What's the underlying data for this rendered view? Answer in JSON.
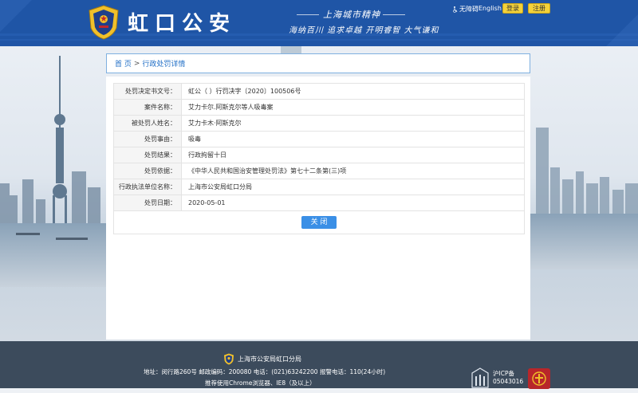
{
  "header": {
    "brand_title": "虹口公安",
    "slogan_top": "上海城市精神",
    "slogan_bottom": "海纳百川 追求卓越 开明睿智 大气谦和",
    "accessibility_label": "无障碍",
    "english_label": "English",
    "login_label": "登录",
    "register_label": "注册"
  },
  "breadcrumb": {
    "home": "首 页",
    "separator": ">",
    "current": "行政处罚详情"
  },
  "detail": {
    "rows": [
      {
        "label": "处罚决定书文号：",
        "value": "虹公（ ）行罚决字〔2020〕100506号"
      },
      {
        "label": "案件名称：",
        "value": "艾力卡尔.阿斯克尔等人吸毒案"
      },
      {
        "label": "被处罚人姓名：",
        "value": "艾力卡木·阿斯克尔"
      },
      {
        "label": "处罚事由：",
        "value": "吸毒"
      },
      {
        "label": "处罚结果：",
        "value": "行政拘留十日"
      },
      {
        "label": "处罚依据：",
        "value": "《中华人民共和国治安管理处罚法》第七十二条第(三)项"
      },
      {
        "label": "行政执法单位名称：",
        "value": "上海市公安局虹口分局"
      },
      {
        "label": "处罚日期：",
        "value": "2020-05-01"
      }
    ],
    "close_label": "关 闭"
  },
  "footer": {
    "org_name": "上海市公安局虹口分局",
    "address_line": "地址：闵行路260号 邮政编码：200080 电话：(021)63242200 报警电话：110(24小时)",
    "browser_line": "推荐使用Chrome浏览器、IE8（及以上）",
    "icp_label": "沪ICP备",
    "icp_number": "05043016"
  },
  "colors": {
    "header_blue": "#1f55a6",
    "button_yellow": "#f4d23a",
    "link_blue": "#1f6ec6",
    "close_button_blue": "#3a8fe6",
    "footer_gray": "#3c4b5c"
  }
}
